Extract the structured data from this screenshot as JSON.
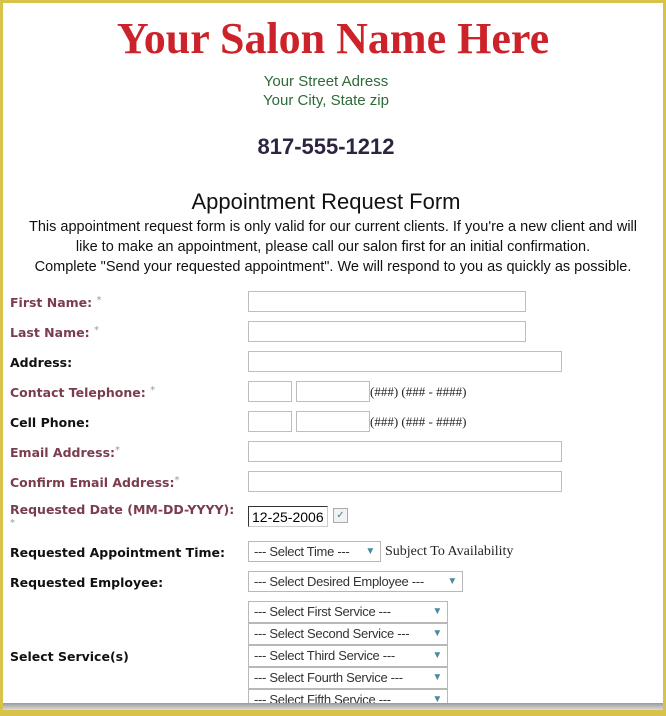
{
  "header": {
    "salon_name": "Your Salon Name Here",
    "street": "Your Street Adress",
    "city": "Your City, State zip",
    "phone": "817-555-1212"
  },
  "form": {
    "title": "Appointment Request Form",
    "intro": [
      "This appointment request form is only valid for our current clients. If you're a new client and will",
      "like to make an appointment, please call our salon first for an initial confirmation.",
      "Complete \"Send your requested appointment\". We will respond to you as quickly as possible."
    ],
    "required_mark": "*",
    "fields": {
      "first_name": "First Name:",
      "last_name": "Last Name:",
      "address": "Address:",
      "contact_phone": "Contact Telephone:",
      "cell_phone": "Cell Phone:",
      "email": "Email Address:",
      "confirm_email": "Confirm Email Address:",
      "date": "Requested Date (MM-DD-YYYY):",
      "time": "Requested Appointment Time:",
      "employee": "Requested Employee:",
      "services": "Select Service(s)"
    },
    "phone_hint": "(###) (### - ####)",
    "date_value": "12-25-2006",
    "time_select": "--- Select Time ---",
    "time_note": "Subject To Availability",
    "employee_select": "--- Select Desired Employee ---",
    "service_selects": [
      "--- Select First Service ---",
      "--- Select Second Service ---",
      "--- Select Third Service ---",
      "--- Select Fourth Service ---",
      "--- Select Fifth Service ---"
    ]
  },
  "colors": {
    "title": "#cc2229",
    "address": "#2f6a3a",
    "required_label": "#7a3d4d",
    "border": "#d9c24a"
  },
  "icons": {
    "calendar": "calendar-icon",
    "dropdown": "chevron-down-icon"
  }
}
